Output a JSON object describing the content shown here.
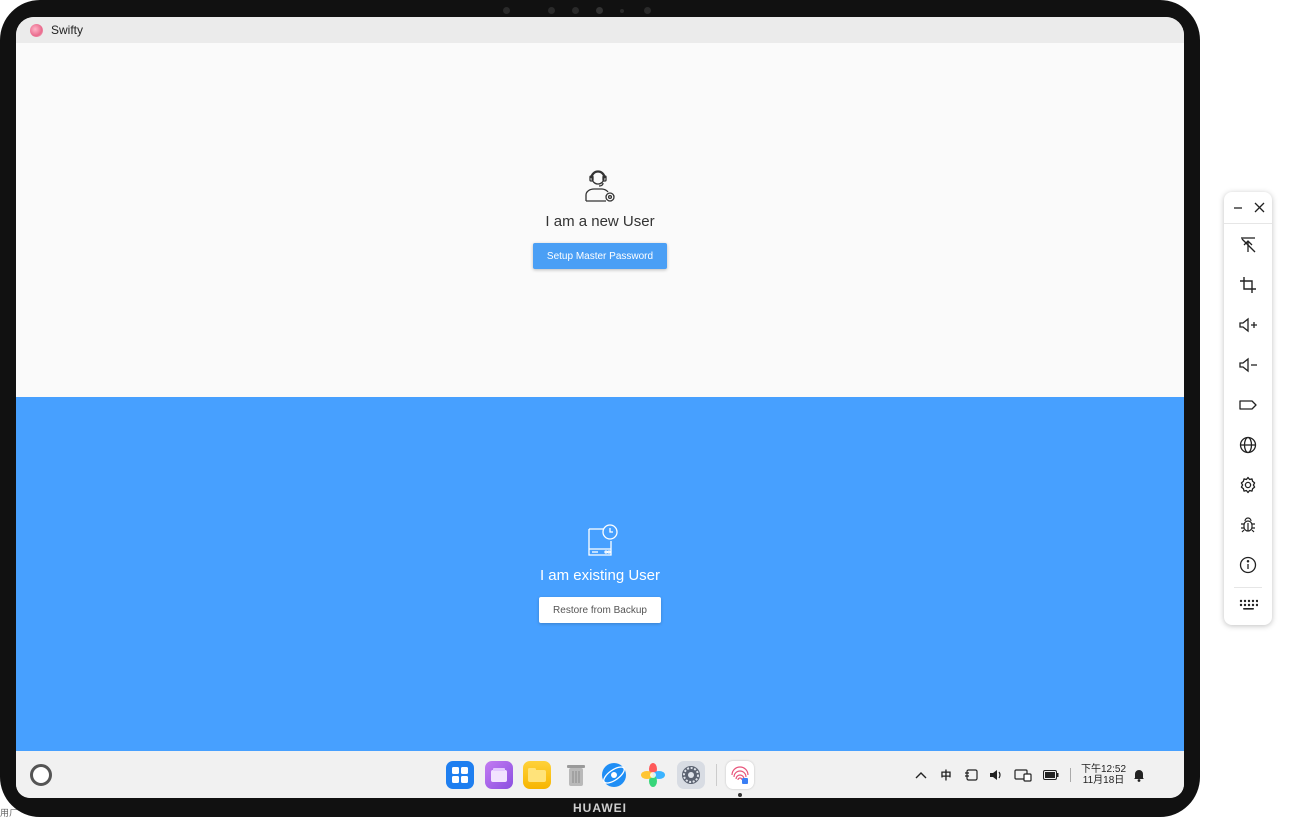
{
  "window": {
    "app_title": "Swifty"
  },
  "new_user": {
    "heading": "I am a new User",
    "button_label": "Setup Master Password"
  },
  "existing_user": {
    "heading": "I am existing User",
    "button_label": "Restore from Backup"
  },
  "device": {
    "brand": "HUAWEI"
  },
  "taskbar": {
    "dock_apps": [
      "app-center-icon",
      "multi-window-icon",
      "files-icon",
      "trash-icon",
      "browser-icon",
      "gallery-icon",
      "settings-icon",
      "swifty-app-icon"
    ],
    "tray": {
      "ime_label": "中",
      "time": "下午12:52",
      "date": "11月18日"
    }
  },
  "sidebar_tools": [
    "pointer-off-icon",
    "crop-icon",
    "volume-up-icon",
    "volume-down-icon",
    "tag-icon",
    "globe-icon",
    "gear-icon",
    "bug-icon",
    "info-icon",
    "keyboard-icon"
  ],
  "edge_text": "用ㄏ",
  "colors": {
    "accent_blue": "#47a0ff",
    "button_blue": "#4a9ff5",
    "top_panel_bg": "#fafafa"
  }
}
